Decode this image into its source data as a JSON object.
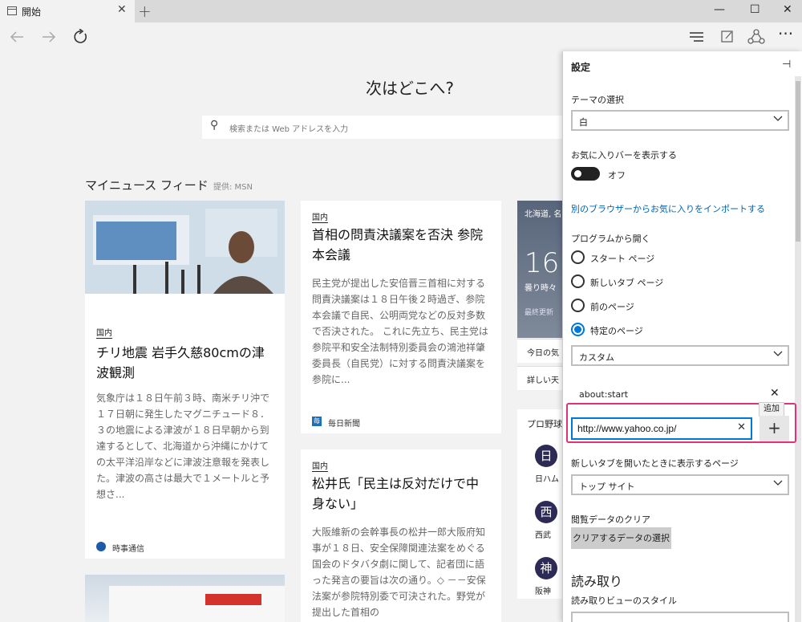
{
  "window": {
    "tab_title": "開始",
    "tab_close": "✕",
    "new_tab": "+",
    "minimize": "—",
    "maximize": "☐",
    "close": "✕"
  },
  "toolbar": {
    "back_icon": "back-arrow-icon",
    "forward_icon": "forward-arrow-icon",
    "refresh_icon": "refresh-icon",
    "hub_icon": "hub-icon",
    "note_icon": "web-note-icon",
    "share_icon": "share-icon",
    "more": "···"
  },
  "start": {
    "heading": "次はどこへ?",
    "search_placeholder": "検索または Web アドレスを入力",
    "feed_title": "マイニュース フィード",
    "feed_provider": "提供: MSN"
  },
  "cards": {
    "chile": {
      "category": "国内",
      "headline": "チリ地震 岩手久慈80cmの津波観測",
      "body": "気象庁は１８日午前３時、南米チリ沖で１７日朝に発生したマグニチュード８．３の地震による津波が１８日早朝から到達するとして、北海道から沖縄にかけての太平洋沿岸などに津波注意報を発表した。津波の高さは最大で１メートルと予想さ...",
      "source": "時事通信"
    },
    "censure": {
      "category": "国内",
      "headline": "首相の問責決議案を否決 参院本会議",
      "body": "民主党が提出した安倍晋三首相に対する問責決議案は１８日午後２時過ぎ、参院本会議で自民、公明両党などの反対多数で否決された。 これに先立ち、民主党は参院平和安全法制特別委員会の鴻池祥肇委員長（自民党）に対する問責決議案を参院に...",
      "source": "毎日新聞"
    },
    "matsui": {
      "category": "国内",
      "headline": "松井氏「民主は反対だけで中身ない」",
      "body": "大阪維新の会幹事長の松井一郎大阪府知事が１８日、安全保障関連法案をめぐる国会のドタバタ劇に関して、記者団に語った発言の要旨は次の通り。◇ －－安保法案が参院特別委で可決された。野党が提出した首相の"
    }
  },
  "weather": {
    "city": "北海道, 名",
    "temp": "16°",
    "desc": "曇り時々",
    "updated": "最終更新",
    "today_link": "今日の気",
    "detail_link": "詳しい天"
  },
  "sports": {
    "title": "プロ野球",
    "teams": [
      {
        "badge": "日",
        "name": "日ハム"
      },
      {
        "badge": "西",
        "name": "西武"
      },
      {
        "badge": "神",
        "name": "阪神"
      }
    ]
  },
  "settings": {
    "title": "設定",
    "pin": "⊣",
    "theme_label": "テーマの選択",
    "theme_value": "白",
    "favbar_label": "お気に入りバーを表示する",
    "favbar_state": "オフ",
    "import_link": "別のブラウザーからお気に入りをインポートする",
    "open_with_label": "プログラムから開く",
    "open_options": [
      "スタート ページ",
      "新しいタブ ページ",
      "前のページ",
      "特定のページ"
    ],
    "open_selected": "特定のページ",
    "specific_select": "カスタム",
    "page_item": "about:start",
    "add_tooltip": "追加",
    "url_value": "http://www.yahoo.co.jp/",
    "clear_icon": "✕",
    "add_icon": "+",
    "newtab_label": "新しいタブを開いたときに表示するページ",
    "newtab_value": "トップ サイト",
    "clear_data_label": "閲覧データのクリア",
    "clear_data_button": "クリアするデータの選択",
    "reading_heading": "読み取り",
    "reading_style_label": "読み取りビューのスタイル",
    "accent_color": "#0078d7",
    "highlight_color": "#e0337a"
  }
}
